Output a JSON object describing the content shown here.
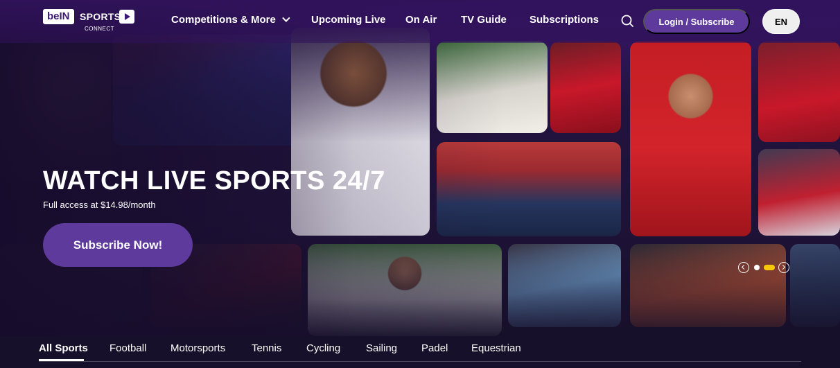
{
  "nav": {
    "logo": {
      "bein": "beIN",
      "sports": "SPORTS",
      "connect": "CONNECT"
    },
    "items": [
      {
        "label": "Competitions & More",
        "has_dropdown": true,
        "icon": "chevron-down-icon"
      },
      {
        "label": "Upcoming Live"
      },
      {
        "label": "On Air"
      },
      {
        "label": "TV Guide"
      },
      {
        "label": "Subscriptions"
      }
    ],
    "search_icon": "search-icon",
    "login_label": "Login / Subscribe",
    "language": "EN"
  },
  "hero": {
    "title": "WATCH LIVE SPORTS 24/7",
    "subtitle": "Full access at $14.98/month",
    "cta_label": "Subscribe Now!",
    "carousel": {
      "slide_count": 2,
      "active_index": 1,
      "prev_icon": "chevron-left-icon",
      "next_icon": "chevron-right-icon"
    }
  },
  "sport_tabs": {
    "items": [
      "All Sports",
      "Football",
      "Motorsports",
      "Tennis",
      "Cycling",
      "Sailing",
      "Padel",
      "Equestrian"
    ],
    "active_index": 0
  },
  "colors": {
    "accent": "#5d3a9c",
    "nav_bg": "#30125a",
    "page_bg": "#17102a",
    "carousel_active": "#f6c80b"
  }
}
